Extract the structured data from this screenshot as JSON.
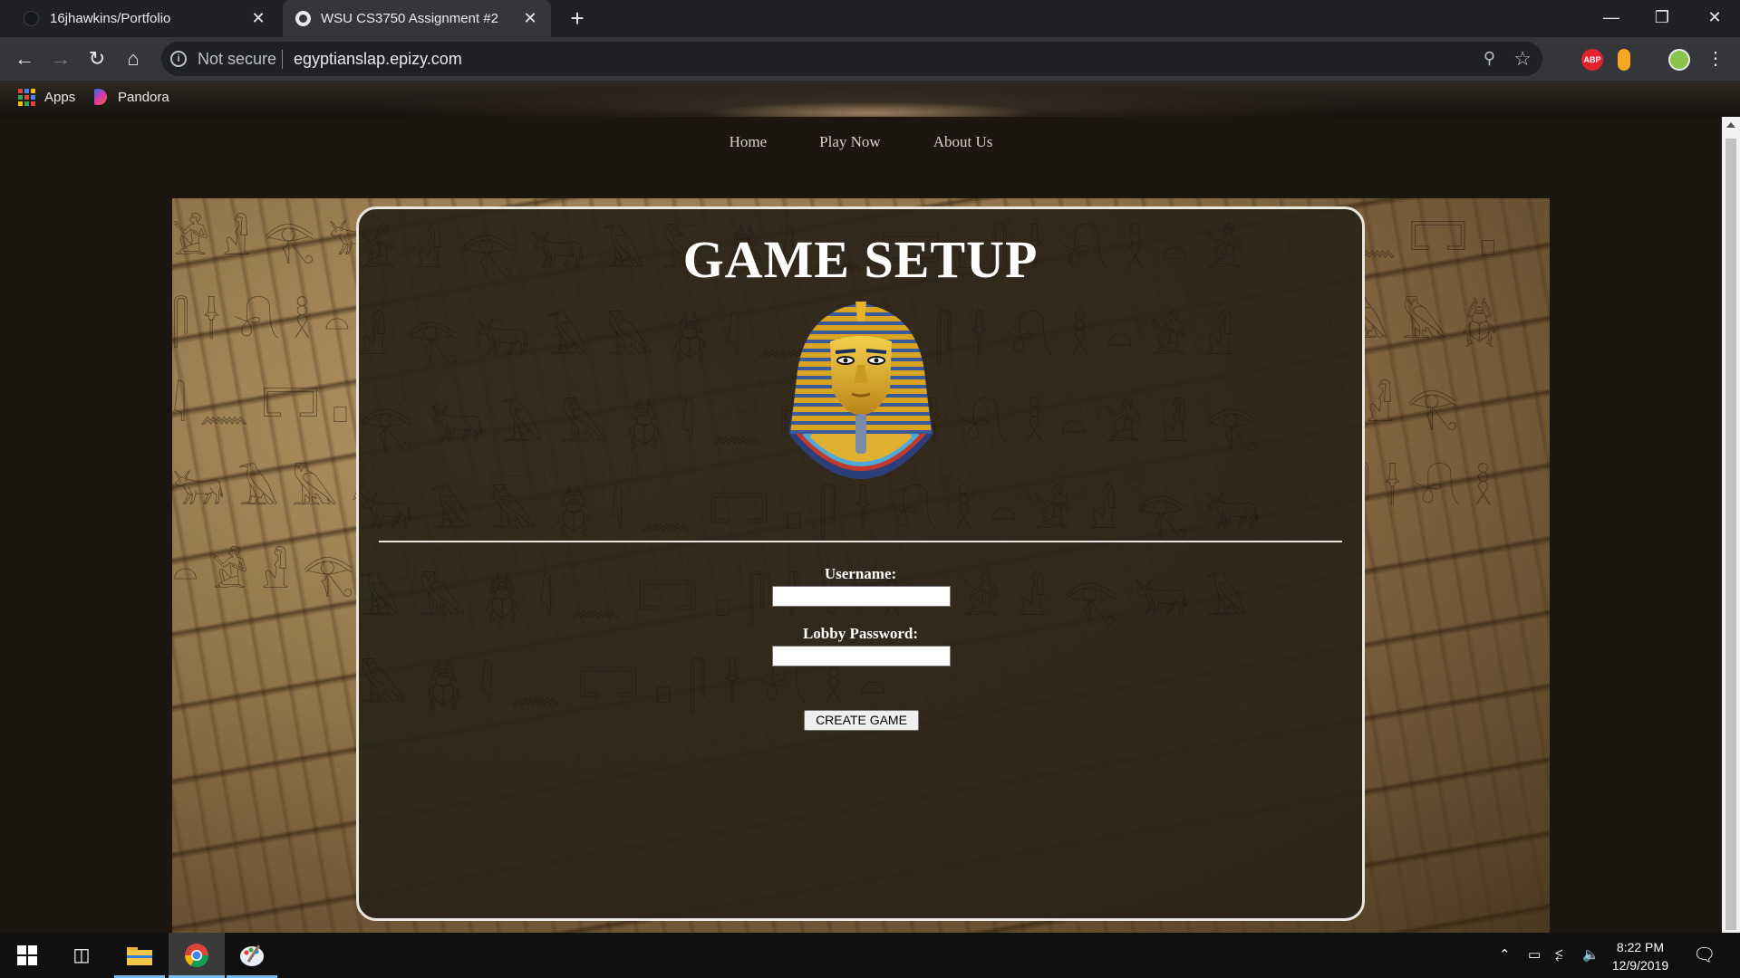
{
  "browser": {
    "tabs": [
      {
        "title": "16jhawkins/Portfolio"
      },
      {
        "title": "WSU CS3750 Assignment #2"
      }
    ],
    "new_tab_symbol": "+",
    "close_symbol": "✕",
    "address": {
      "security_text": "Not secure",
      "url": "egyptianslap.epizy.com"
    },
    "bookmarks": [
      {
        "label": "Apps"
      },
      {
        "label": "Pandora"
      }
    ],
    "extensions": [
      {
        "name": "adblock-icon",
        "label": "ABP",
        "color": "#e4212e"
      },
      {
        "name": "extension-icon",
        "color": "#f5a623"
      },
      {
        "name": "profile-avatar",
        "color": "#8bc34a"
      }
    ]
  },
  "page": {
    "nav": [
      {
        "label": "Home"
      },
      {
        "label": "Play Now"
      },
      {
        "label": "About Us"
      }
    ],
    "title": "GAME SETUP",
    "form": {
      "username_label": "Username:",
      "username_value": "",
      "password_label": "Lobby Password:",
      "password_value": "",
      "submit_label": "CREATE GAME"
    }
  },
  "taskbar": {
    "apps": [
      {
        "name": "start-icon"
      },
      {
        "name": "task-view-icon"
      },
      {
        "name": "file-explorer-icon"
      },
      {
        "name": "chrome-icon"
      },
      {
        "name": "paint-icon"
      }
    ],
    "time": "8:22 PM",
    "date": "12/9/2019"
  },
  "colors": {
    "page_bg": "#1b160f",
    "panel_border": "#e9e6e0",
    "nav_text": "#dcd2c1",
    "taskbar_accent": "#76b9ed"
  }
}
